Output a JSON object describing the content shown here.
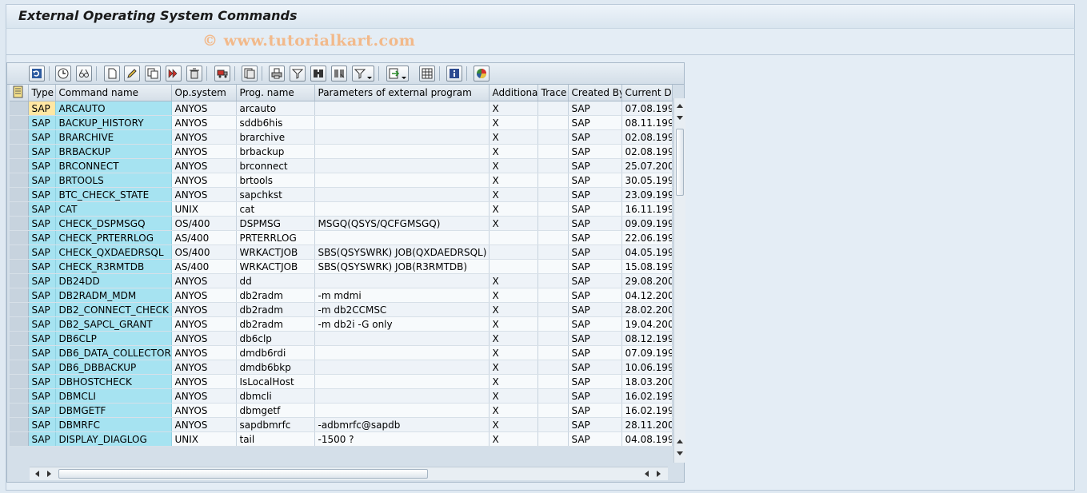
{
  "window": {
    "title": "External Operating System Commands",
    "watermark": "© www.tutorialkart.com"
  },
  "toolbar": {
    "icons": [
      "refresh-icon",
      "details-icon",
      "glasses-icon",
      "create-icon",
      "change-icon",
      "copy-icon",
      "copy-multiple-icon",
      "delete-icon",
      "transport-icon",
      "copy-clipboard-icon",
      "sort-ascending-icon",
      "filter-icon",
      "find-icon",
      "find-next-icon",
      "set-filter-icon",
      "export-icon",
      "change-layout-icon",
      "info-icon",
      "graphic-icon"
    ]
  },
  "table": {
    "columns": [
      "Type",
      "Command name",
      "Op.system",
      "Prog. name",
      "Parameters of external program",
      "Additional",
      "Trace",
      "Created By",
      "Current D"
    ],
    "rows": [
      [
        "SAP",
        "ARCAUTO",
        "ANYOS",
        "arcauto",
        "",
        "X",
        "",
        "SAP",
        "07.08.199"
      ],
      [
        "SAP",
        "BACKUP_HISTORY",
        "ANYOS",
        "sddb6his",
        "",
        "X",
        "",
        "SAP",
        "08.11.199"
      ],
      [
        "SAP",
        "BRARCHIVE",
        "ANYOS",
        "brarchive",
        "",
        "X",
        "",
        "SAP",
        "02.08.199"
      ],
      [
        "SAP",
        "BRBACKUP",
        "ANYOS",
        "brbackup",
        "",
        "X",
        "",
        "SAP",
        "02.08.199"
      ],
      [
        "SAP",
        "BRCONNECT",
        "ANYOS",
        "brconnect",
        "",
        "X",
        "",
        "SAP",
        "25.07.200"
      ],
      [
        "SAP",
        "BRTOOLS",
        "ANYOS",
        "brtools",
        "",
        "X",
        "",
        "SAP",
        "30.05.199"
      ],
      [
        "SAP",
        "BTC_CHECK_STATE",
        "ANYOS",
        "sapchkst",
        "",
        "X",
        "",
        "SAP",
        "23.09.199"
      ],
      [
        "SAP",
        "CAT",
        "UNIX",
        "cat",
        "",
        "X",
        "",
        "SAP",
        "16.11.199"
      ],
      [
        "SAP",
        "CHECK_DSPMSGQ",
        "OS/400",
        "DSPMSG",
        "MSGQ(QSYS/QCFGMSGQ)",
        "X",
        "",
        "SAP",
        "09.09.199"
      ],
      [
        "SAP",
        "CHECK_PRTERRLOG",
        "AS/400",
        "PRTERRLOG",
        "",
        "",
        "",
        "SAP",
        "22.06.199"
      ],
      [
        "SAP",
        "CHECK_QXDAEDRSQL",
        "OS/400",
        "WRKACTJOB",
        "SBS(QSYSWRK) JOB(QXDAEDRSQL)",
        "",
        "",
        "SAP",
        "04.05.199"
      ],
      [
        "SAP",
        "CHECK_R3RMTDB",
        "AS/400",
        "WRKACTJOB",
        "SBS(QSYSWRK) JOB(R3RMTDB)",
        "",
        "",
        "SAP",
        "15.08.199"
      ],
      [
        "SAP",
        "DB24DD",
        "ANYOS",
        "dd",
        "",
        "X",
        "",
        "SAP",
        "29.08.200"
      ],
      [
        "SAP",
        "DB2RADM_MDM",
        "ANYOS",
        "db2radm",
        "-m mdmi",
        "X",
        "",
        "SAP",
        "04.12.200"
      ],
      [
        "SAP",
        "DB2_CONNECT_CHECK",
        "ANYOS",
        "db2radm",
        "-m db2CCMSC",
        "X",
        "",
        "SAP",
        "28.02.200"
      ],
      [
        "SAP",
        "DB2_SAPCL_GRANT",
        "ANYOS",
        "db2radm",
        "-m db2i -G only",
        "X",
        "",
        "SAP",
        "19.04.200"
      ],
      [
        "SAP",
        "DB6CLP",
        "ANYOS",
        "db6clp",
        "",
        "X",
        "",
        "SAP",
        "08.12.199"
      ],
      [
        "SAP",
        "DB6_DATA_COLLECTOR",
        "ANYOS",
        "dmdb6rdi",
        "",
        "X",
        "",
        "SAP",
        "07.09.199"
      ],
      [
        "SAP",
        "DB6_DBBACKUP",
        "ANYOS",
        "dmdb6bkp",
        "",
        "X",
        "",
        "SAP",
        "10.06.199"
      ],
      [
        "SAP",
        "DBHOSTCHECK",
        "ANYOS",
        "IsLocalHost",
        "",
        "X",
        "",
        "SAP",
        "18.03.200"
      ],
      [
        "SAP",
        "DBMCLI",
        "ANYOS",
        "dbmcli",
        "",
        "X",
        "",
        "SAP",
        "16.02.199"
      ],
      [
        "SAP",
        "DBMGETF",
        "ANYOS",
        "dbmgetf",
        "",
        "X",
        "",
        "SAP",
        "16.02.199"
      ],
      [
        "SAP",
        "DBMRFC",
        "ANYOS",
        "sapdbmrfc",
        "-adbmrfc@sapdb",
        "X",
        "",
        "SAP",
        "28.11.200"
      ],
      [
        "SAP",
        "DISPLAY_DIAGLOG",
        "UNIX",
        "tail",
        "-1500 ?",
        "X",
        "",
        "SAP",
        "04.08.199"
      ]
    ]
  },
  "colors": {
    "key_column": "#a6e3f1",
    "active_cell": "#ffe7a3",
    "background": "#dfe9f2"
  }
}
